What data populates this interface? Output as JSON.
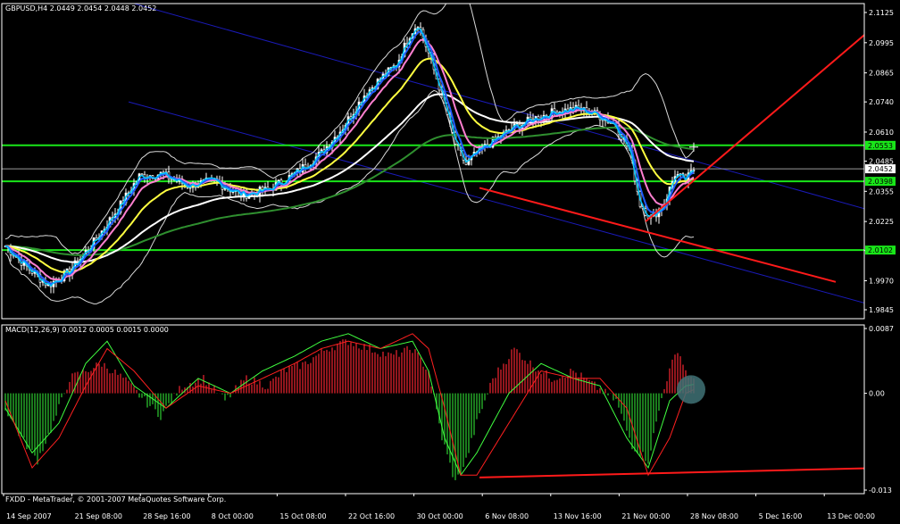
{
  "colors": {
    "background": "#000000",
    "frame": "#ffffff",
    "bull_candle": "#ffffff",
    "bear_candle": "#ffffff",
    "ma_fast_blue": "#1e5cff",
    "ma_cyan": "#00c8ff",
    "ma_pink": "#ff7fd0",
    "ma_yellow": "#ffff40",
    "ma_white": "#ffffff",
    "ma_green": "#2f8f2f",
    "bollinger": "#d8d8d8",
    "channel_blue": "#1a1ab8",
    "support_green": "#19e619",
    "trend_red": "#ff1a1a",
    "macd_hist_pos": "#d0202a",
    "macd_hist_neg": "#27b02a",
    "macd_signal": "#ff2020",
    "macd_main": "#40ff40",
    "circle_highlight": "#3f7276"
  },
  "chart_data": [
    {
      "type": "candlestick",
      "title": "GBPUSD,H4  2.0449 2.0454 2.0448 2.0452",
      "ylim": [
        1.9845,
        2.1125
      ],
      "y_ticks": [
        "2.1125",
        "2.0995",
        "2.0865",
        "2.0740",
        "2.0610",
        "2.0485",
        "2.0355",
        "2.0225",
        "2.0100",
        "1.9970",
        "1.9845"
      ],
      "x_ticks": [
        "14 Sep 2007",
        "21 Sep 08:00",
        "28 Sep 16:00",
        "8 Oct 00:00",
        "15 Oct 08:00",
        "22 Oct 16:00",
        "30 Oct 00:00",
        "6 Nov 08:00",
        "13 Nov 16:00",
        "21 Nov 00:00",
        "28 Nov 08:00",
        "5 Dec 16:00",
        "13 Dec 00:00"
      ],
      "price_tags": [
        {
          "value": 2.0553,
          "label": "2.0553",
          "style": "green"
        },
        {
          "value": 2.0452,
          "label": "2.0452",
          "style": "white"
        },
        {
          "value": 2.0398,
          "label": "2.0398",
          "style": "green"
        },
        {
          "value": 2.0102,
          "label": "2.0102",
          "style": "green"
        }
      ],
      "horizontal_levels": [
        2.0553,
        2.0398,
        2.0102
      ],
      "current_price": 2.0452,
      "close_series_anchors": [
        [
          0,
          2.012
        ],
        [
          8,
          2.003
        ],
        [
          16,
          1.995
        ],
        [
          24,
          2.001
        ],
        [
          34,
          2.015
        ],
        [
          42,
          2.028
        ],
        [
          50,
          2.042
        ],
        [
          58,
          2.043
        ],
        [
          68,
          2.038
        ],
        [
          78,
          2.04
        ],
        [
          88,
          2.034
        ],
        [
          98,
          2.036
        ],
        [
          108,
          2.043
        ],
        [
          118,
          2.052
        ],
        [
          126,
          2.063
        ],
        [
          134,
          2.077
        ],
        [
          140,
          2.084
        ],
        [
          146,
          2.09
        ],
        [
          151,
          2.103
        ],
        [
          154,
          2.108
        ],
        [
          158,
          2.095
        ],
        [
          163,
          2.077
        ],
        [
          168,
          2.056
        ],
        [
          172,
          2.047
        ],
        [
          176,
          2.052
        ],
        [
          182,
          2.057
        ],
        [
          190,
          2.063
        ],
        [
          198,
          2.067
        ],
        [
          206,
          2.07
        ],
        [
          214,
          2.071
        ],
        [
          222,
          2.068
        ],
        [
          228,
          2.064
        ],
        [
          233,
          2.053
        ],
        [
          237,
          2.03
        ],
        [
          241,
          2.024
        ],
        [
          246,
          2.03
        ],
        [
          250,
          2.043
        ],
        [
          254,
          2.04
        ],
        [
          257,
          2.045
        ]
      ],
      "ma_offsets": {
        "cyan": 1,
        "blue": 2,
        "pink": 5,
        "yellow": 12,
        "white": 32,
        "green": 60
      },
      "trendlines": [
        {
          "name": "red-support",
          "from": [
            177,
            2.037
          ],
          "to": [
            310,
            1.9965
          ]
        },
        {
          "name": "red-rise",
          "from": [
            239,
            2.0225
          ],
          "to": [
            330,
            2.112
          ]
        },
        {
          "name": "blue-channel-upper",
          "from": [
            46,
            2.117
          ],
          "to": [
            330,
            2.025
          ]
        },
        {
          "name": "blue-channel-lower",
          "from": [
            46,
            2.074
          ],
          "to": [
            330,
            1.9845
          ]
        }
      ]
    },
    {
      "type": "macd",
      "title": "MACD(12,26,9) 0.0012 0.0005 0.0015 0.0000",
      "ylim": [
        -0.013,
        0.0087
      ],
      "y_ticks": [
        "0.0087",
        "0.00",
        "-0.013"
      ],
      "histogram_anchors": [
        [
          0,
          -0.002
        ],
        [
          6,
          -0.006
        ],
        [
          12,
          -0.009
        ],
        [
          18,
          -0.004
        ],
        [
          24,
          0.002
        ],
        [
          30,
          0.003
        ],
        [
          36,
          0.004
        ],
        [
          44,
          0.002
        ],
        [
          52,
          -0.001
        ],
        [
          58,
          -0.003
        ],
        [
          66,
          0.001
        ],
        [
          74,
          0.002
        ],
        [
          82,
          -0.001
        ],
        [
          90,
          0.002
        ],
        [
          98,
          0.001
        ],
        [
          104,
          0.003
        ],
        [
          112,
          0.004
        ],
        [
          120,
          0.006
        ],
        [
          128,
          0.007
        ],
        [
          136,
          0.006
        ],
        [
          144,
          0.005
        ],
        [
          152,
          0.006
        ],
        [
          158,
          0.003
        ],
        [
          163,
          -0.006
        ],
        [
          168,
          -0.012
        ],
        [
          172,
          -0.009
        ],
        [
          176,
          -0.004
        ],
        [
          182,
          0.002
        ],
        [
          190,
          0.006
        ],
        [
          196,
          0.004
        ],
        [
          204,
          0.002
        ],
        [
          212,
          0.003
        ],
        [
          220,
          0.001
        ],
        [
          228,
          -0.001
        ],
        [
          234,
          -0.007
        ],
        [
          240,
          -0.009
        ],
        [
          246,
          0.001
        ],
        [
          251,
          0.006
        ],
        [
          254,
          0.003
        ],
        [
          257,
          0.0015
        ]
      ],
      "signal_red_anchors": [
        [
          0,
          -0.001
        ],
        [
          10,
          -0.01
        ],
        [
          20,
          -0.006
        ],
        [
          30,
          0.001
        ],
        [
          38,
          0.006
        ],
        [
          48,
          0.003
        ],
        [
          60,
          -0.002
        ],
        [
          72,
          0.001
        ],
        [
          84,
          0.0
        ],
        [
          96,
          0.002
        ],
        [
          108,
          0.004
        ],
        [
          118,
          0.006
        ],
        [
          128,
          0.007
        ],
        [
          140,
          0.006
        ],
        [
          152,
          0.008
        ],
        [
          158,
          0.006
        ],
        [
          164,
          -0.002
        ],
        [
          170,
          -0.011
        ],
        [
          176,
          -0.011
        ],
        [
          188,
          -0.004
        ],
        [
          200,
          0.003
        ],
        [
          212,
          0.002
        ],
        [
          222,
          0.002
        ],
        [
          232,
          -0.002
        ],
        [
          240,
          -0.011
        ],
        [
          248,
          -0.006
        ],
        [
          254,
          0.0
        ],
        [
          257,
          0.0005
        ]
      ],
      "main_green_anchors": [
        [
          0,
          -0.002
        ],
        [
          10,
          -0.008
        ],
        [
          20,
          -0.004
        ],
        [
          30,
          0.004
        ],
        [
          38,
          0.007
        ],
        [
          48,
          0.001
        ],
        [
          60,
          -0.002
        ],
        [
          72,
          0.002
        ],
        [
          84,
          0.0
        ],
        [
          96,
          0.003
        ],
        [
          108,
          0.005
        ],
        [
          118,
          0.007
        ],
        [
          128,
          0.008
        ],
        [
          140,
          0.006
        ],
        [
          152,
          0.007
        ],
        [
          158,
          0.003
        ],
        [
          164,
          -0.006
        ],
        [
          170,
          -0.011
        ],
        [
          176,
          -0.008
        ],
        [
          188,
          0.0
        ],
        [
          200,
          0.004
        ],
        [
          212,
          0.002
        ],
        [
          222,
          0.001
        ],
        [
          232,
          -0.006
        ],
        [
          240,
          -0.01
        ],
        [
          248,
          -0.001
        ],
        [
          254,
          0.001
        ],
        [
          257,
          0.0012
        ]
      ],
      "trendline": {
        "from": [
          177,
          -0.0113
        ],
        "to": [
          330,
          -0.01
        ]
      }
    }
  ],
  "footer": {
    "copyright": "FXDD - MetaTrader, © 2001-2007 MetaQuotes Software Corp."
  }
}
